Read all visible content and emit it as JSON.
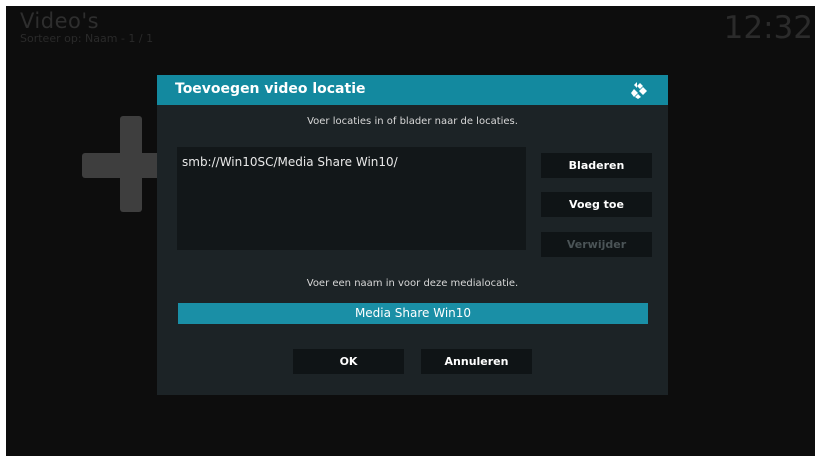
{
  "background": {
    "title": "Video's",
    "subtitle": "Sorteer op: Naam  -  1 / 1",
    "clock": "12:32",
    "add_icon": "plus-icon"
  },
  "dialog": {
    "title": "Toevoegen video locatie",
    "logo_icon": "kodi-logo-icon",
    "path_hint": "Voer locaties in of blader naar de locaties.",
    "paths": [
      "smb://Win10SC/Media Share Win10/"
    ],
    "buttons": {
      "browse": "Bladeren",
      "add": "Voeg toe",
      "remove": "Verwijder"
    },
    "name_hint": "Voer een naam in voor deze medialocatie.",
    "name_value": "Media Share Win10",
    "ok": "OK",
    "cancel": "Annuleren"
  },
  "colors": {
    "accent": "#13899f",
    "dialog_bg": "#1c2326",
    "screen_bg": "#0d0d0d"
  }
}
